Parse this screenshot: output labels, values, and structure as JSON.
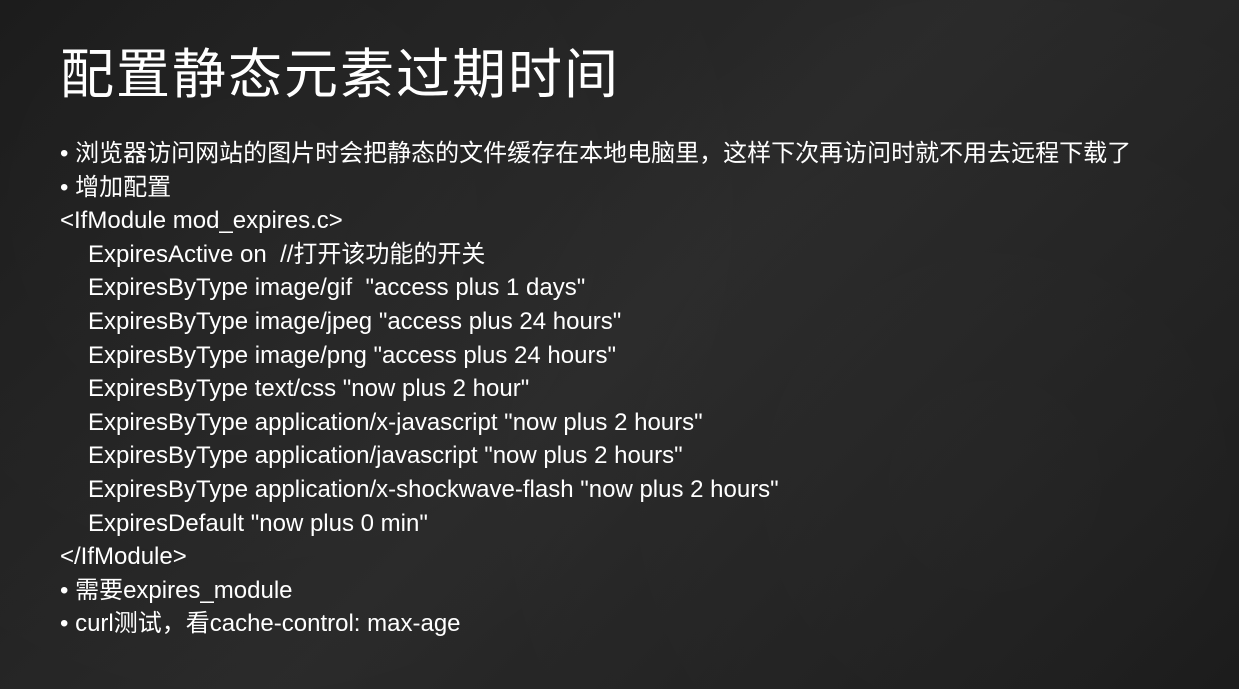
{
  "slide": {
    "title": "配置静态元素过期时间",
    "bullet1": "• 浏览器访问网站的图片时会把静态的文件缓存在本地电脑里，这样下次再访问时就不用去远程下载了",
    "bullet2": "• 增加配置",
    "code": {
      "line1": "<IfModule mod_expires.c>",
      "line2": "ExpiresActive on  //打开该功能的开关",
      "line3": "ExpiresByType image/gif  \"access plus 1 days\"",
      "line4": "ExpiresByType image/jpeg \"access plus 24 hours\"",
      "line5": "ExpiresByType image/png \"access plus 24 hours\"",
      "line6": "ExpiresByType text/css \"now plus 2 hour\"",
      "line7": "ExpiresByType application/x-javascript \"now plus 2 hours\"",
      "line8": "ExpiresByType application/javascript \"now plus 2 hours\"",
      "line9": "ExpiresByType application/x-shockwave-flash \"now plus 2 hours\"",
      "line10": "ExpiresDefault \"now plus 0 min\"",
      "line11": "</IfModule>"
    },
    "bullet3": "• 需要expires_module",
    "bullet4": "• curl测试，看cache-control: max-age"
  }
}
